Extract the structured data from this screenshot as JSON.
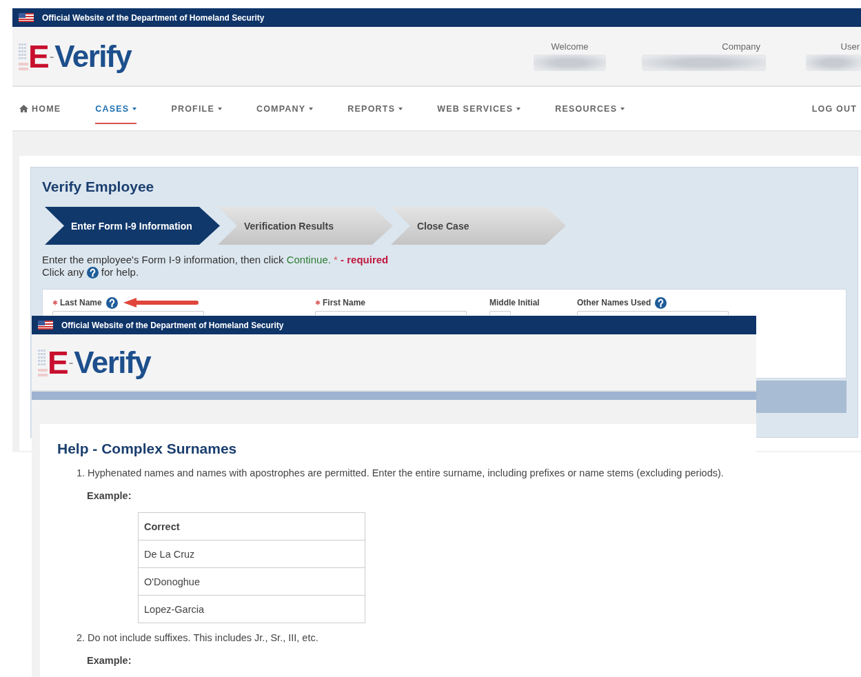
{
  "background_page": {
    "gov_banner": "Official Website of the Department of Homeland Security",
    "logo": {
      "letter": "E",
      "dash": "-",
      "word": "Verify"
    },
    "user_info": [
      {
        "label": "Welcome"
      },
      {
        "label": "Company"
      },
      {
        "label": "User"
      }
    ],
    "nav": [
      {
        "label": "HOME",
        "kind": "home",
        "dropdown": false,
        "selected": false
      },
      {
        "label": "CASES",
        "kind": "menu",
        "dropdown": true,
        "selected": true
      },
      {
        "label": "PROFILE",
        "kind": "menu",
        "dropdown": true,
        "selected": false
      },
      {
        "label": "COMPANY",
        "kind": "menu",
        "dropdown": true,
        "selected": false
      },
      {
        "label": "REPORTS",
        "kind": "menu",
        "dropdown": true,
        "selected": false
      },
      {
        "label": "WEB SERVICES",
        "kind": "menu",
        "dropdown": true,
        "selected": false
      },
      {
        "label": "RESOURCES",
        "kind": "menu",
        "dropdown": true,
        "selected": false
      },
      {
        "label": "LOG OUT",
        "kind": "logout",
        "dropdown": false,
        "selected": false
      }
    ],
    "page_title": "Verify Employee",
    "steps": [
      {
        "label": "Enter Form I-9 Information",
        "selected": true
      },
      {
        "label": "Verification Results",
        "selected": false
      },
      {
        "label": "Close Case",
        "selected": false
      }
    ],
    "instruction": [
      {
        "text": "Enter the employee's Form I-9 information, then click ",
        "kind": "plain"
      },
      {
        "text": "Continue.",
        "kind": "action"
      },
      {
        "text": " * ",
        "kind": "asterisk"
      },
      {
        "text": "- required",
        "kind": "required"
      }
    ],
    "help_hint": {
      "before": "Click any",
      "after": "for help."
    },
    "fields": [
      {
        "label": "Last Name",
        "required": true,
        "help": true,
        "annotated": true
      },
      {
        "label": "First Name",
        "required": true,
        "help": false,
        "annotated": false
      },
      {
        "label": "Middle Initial",
        "required": false,
        "help": false,
        "annotated": false
      },
      {
        "label": "Other Names Used",
        "required": false,
        "help": true,
        "annotated": false
      }
    ]
  },
  "help_window": {
    "gov_banner": "Official Website of the Department of Homeland Security",
    "logo": {
      "letter": "E",
      "dash": "-",
      "word": "Verify"
    },
    "title": "Help - Complex Surnames",
    "items": [
      {
        "number": "1.",
        "text": "Hyphenated names and names with apostrophes are permitted. Enter the entire surname, including prefixes or name stems (excluding periods).",
        "example_label": "Example:",
        "table": {
          "header": "Correct",
          "rows": [
            "De La Cruz",
            "O'Donoghue",
            "Lopez-Garcia"
          ]
        }
      },
      {
        "number": "2.",
        "text": "Do not include suffixes. This includes Jr., Sr., III, etc.",
        "example_label": "Example:"
      }
    ]
  }
}
